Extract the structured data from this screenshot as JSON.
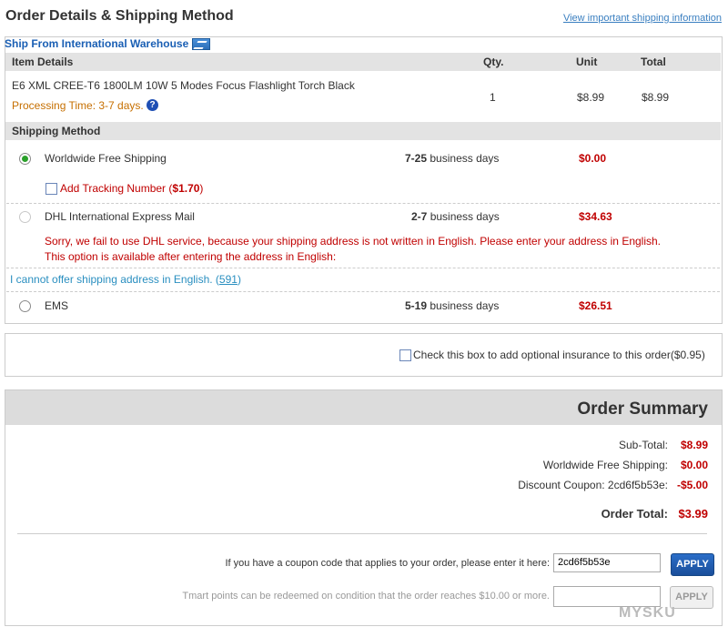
{
  "header": {
    "title": "Order Details & Shipping Method",
    "link": "View important shipping information"
  },
  "ship_from": "Ship From International Warehouse",
  "items_table": {
    "columns": [
      "Item Details",
      "Qty.",
      "Unit",
      "Total"
    ],
    "rows": [
      {
        "name": "E6 XML CREE-T6 1800LM 10W 5 Modes Focus Flashlight Torch Black",
        "processing": "Processing Time: 3-7 days.",
        "qty": "1",
        "unit": "$8.99",
        "total": "$8.99"
      }
    ]
  },
  "shipping": {
    "header": "Shipping Method",
    "options": [
      {
        "name": "Worldwide Free Shipping",
        "days_num": "7-25",
        "days_text": "business days",
        "price": "$0.00",
        "selected": true
      },
      {
        "name": "DHL International Express Mail",
        "days_num": "2-7",
        "days_text": "business days",
        "price": "$34.63",
        "selected": false,
        "disabled": true
      },
      {
        "name": "EMS",
        "days_num": "5-19",
        "days_text": "business days",
        "price": "$26.51",
        "selected": false
      }
    ],
    "tracking_prefix": "Add Tracking Number (",
    "tracking_price": "$1.70",
    "tracking_suffix": ")",
    "dhl_error_1": "Sorry, we fail to use DHL service, because your shipping address is not written in English. Please enter your address in English.",
    "dhl_error_2": "This option is available after entering the address in English:",
    "english_link_text": "I cannot offer shipping address in English. (",
    "english_link_count": "591",
    "english_link_close": ")"
  },
  "insurance": {
    "label": "Check this box to add optional insurance to this order($0.95)"
  },
  "summary": {
    "title": "Order Summary",
    "subtotal_label": "Sub-Total:",
    "subtotal_value": "$8.99",
    "shipping_label": "Worldwide Free Shipping:",
    "shipping_value": "$0.00",
    "coupon_label": "Discount Coupon: 2cd6f5b53e:",
    "coupon_value": "-$5.00",
    "total_label": "Order Total:",
    "total_value": "$3.99"
  },
  "coupon": {
    "prompt": "If you have a coupon code that applies to your order, please enter it here:",
    "value": "2cd6f5b53e",
    "apply_label": "APPLY"
  },
  "points": {
    "prompt": "Tmart points can be redeemed on condition that the order reaches $10.00 or more.",
    "apply_label": "APPLY"
  },
  "watermark": "MYSKU",
  "colors": {
    "accent_red": "#c00000",
    "link_blue": "#3a7fc0",
    "processing_orange": "#c66f00",
    "apply_blue": "#1a4e9a"
  }
}
